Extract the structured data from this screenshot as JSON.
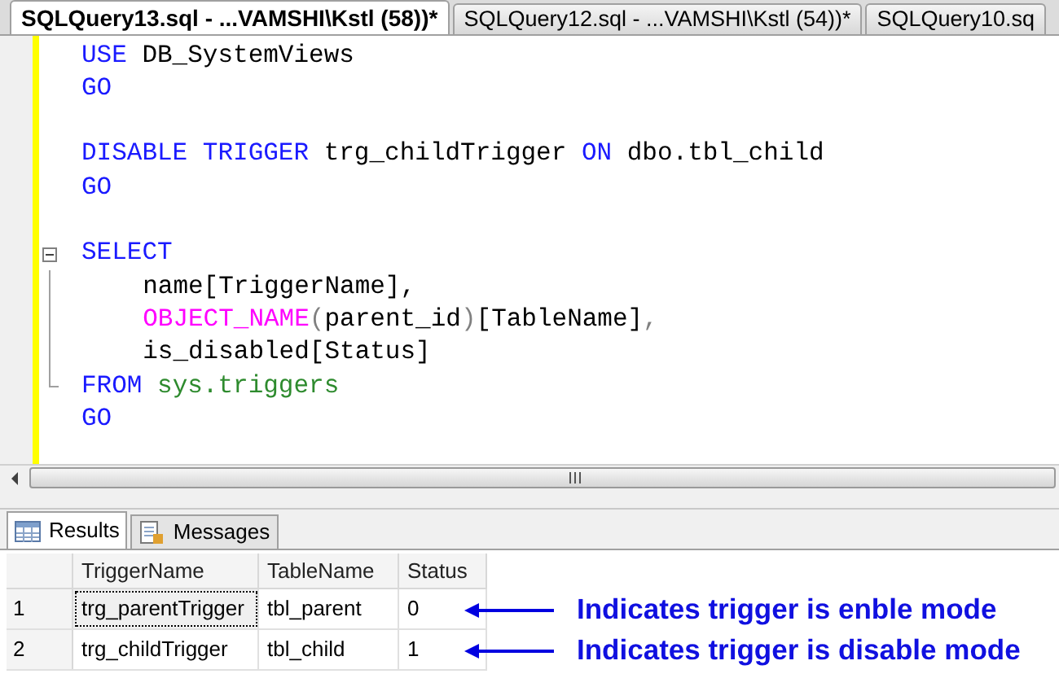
{
  "tabs": [
    {
      "label": "SQLQuery13.sql - ...VAMSHI\\Kstl (58))*",
      "selected": true
    },
    {
      "label": "SQLQuery12.sql - ...VAMSHI\\Kstl (54))*",
      "selected": false
    },
    {
      "label": "SQLQuery10.sq",
      "selected": false
    }
  ],
  "code": [
    {
      "kind": "plain",
      "indented": false,
      "tokens": [
        {
          "kind": "keyword",
          "text": "USE"
        },
        {
          "kind": "plain",
          "text": " DB_SystemViews"
        }
      ]
    },
    {
      "kind": "plain",
      "indented": false,
      "tokens": [
        {
          "kind": "keyword",
          "text": "GO"
        }
      ]
    },
    {
      "kind": "blank"
    },
    {
      "kind": "plain",
      "indented": false,
      "tokens": [
        {
          "kind": "keyword",
          "text": "DISABLE TRIGGER"
        },
        {
          "kind": "plain",
          "text": " trg_childTrigger "
        },
        {
          "kind": "keyword",
          "text": "ON"
        },
        {
          "kind": "plain",
          "text": " dbo.tbl_child"
        }
      ]
    },
    {
      "kind": "plain",
      "indented": false,
      "tokens": [
        {
          "kind": "keyword",
          "text": "GO"
        }
      ]
    },
    {
      "kind": "blank"
    },
    {
      "kind": "fold_start",
      "indented": false,
      "tokens": [
        {
          "kind": "keyword",
          "text": "SELECT"
        }
      ]
    },
    {
      "kind": "fold_body",
      "indented": true,
      "tokens": [
        {
          "kind": "plain",
          "text": "name[TriggerName],"
        }
      ]
    },
    {
      "kind": "fold_body",
      "indented": true,
      "tokens": [
        {
          "kind": "function",
          "text": "OBJECT_NAME"
        },
        {
          "kind": "operator",
          "text": "("
        },
        {
          "kind": "plain",
          "text": "parent_id"
        },
        {
          "kind": "operator",
          "text": ")"
        },
        {
          "kind": "plain",
          "text": "[TableName]"
        },
        {
          "kind": "operator",
          "text": ","
        }
      ]
    },
    {
      "kind": "fold_body",
      "indented": true,
      "tokens": [
        {
          "kind": "plain",
          "text": "is_disabled[Status]"
        }
      ]
    },
    {
      "kind": "fold_end",
      "indented": false,
      "tokens": [
        {
          "kind": "keyword",
          "text": "FROM "
        },
        {
          "kind": "system",
          "text": "sys.triggers"
        }
      ]
    },
    {
      "kind": "plain",
      "indented": false,
      "tokens": [
        {
          "kind": "keyword",
          "text": "GO"
        }
      ]
    }
  ],
  "result_tabs": [
    {
      "label": "Results",
      "selected": true
    },
    {
      "label": "Messages",
      "selected": false
    }
  ],
  "grid": {
    "columns": [
      "TriggerName",
      "TableName",
      "Status"
    ],
    "rows": [
      {
        "number": "1",
        "cells": [
          "trg_parentTrigger",
          "tbl_parent",
          "0"
        ],
        "note": "Indicates trigger is enble mode",
        "focused": true
      },
      {
        "number": "2",
        "cells": [
          "trg_childTrigger",
          "tbl_child",
          "1"
        ],
        "note": "Indicates trigger is disable mode",
        "focused": false
      }
    ]
  }
}
